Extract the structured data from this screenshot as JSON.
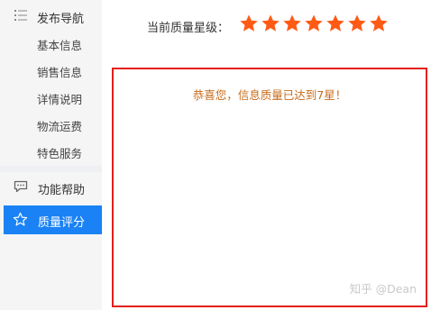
{
  "sidebar": {
    "header_icon": "list-icon",
    "header_label": "发布导航",
    "sub_items": [
      "基本信息",
      "销售信息",
      "详情说明",
      "物流运费",
      "特色服务"
    ],
    "help": {
      "icon": "chat-icon",
      "label": "功能帮助"
    },
    "rating": {
      "icon": "star-outline-icon",
      "label": "质量评分",
      "active_color": "#1a82f5"
    }
  },
  "quality": {
    "label": "当前质量星级：",
    "stars": 7,
    "star_color": "#ff5a14"
  },
  "result": {
    "message": "恭喜您，信息质量已达到7星！",
    "border_color": "#e3201b",
    "watermark": "知乎 @Dean"
  }
}
